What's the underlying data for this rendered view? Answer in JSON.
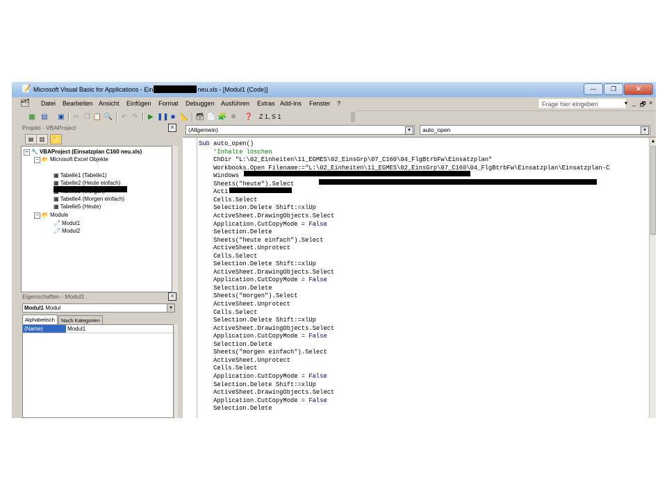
{
  "window": {
    "title_prefix": "Microsoft Visual Basic for Applications - Ein",
    "title_suffix": "neu.xls - [Modul1 (Code)]",
    "buttons": {
      "minimize": "—",
      "restore": "❐",
      "close": "✕"
    }
  },
  "menubar": {
    "items": [
      "Datei",
      "Bearbeiten",
      "Ansicht",
      "Einfügen",
      "Format",
      "Debuggen",
      "Ausführen",
      "Extras",
      "Add-Ins",
      "Fenster",
      "?"
    ],
    "help_placeholder": "Frage hier eingeben",
    "mdi": {
      "dropdown": "▾",
      "minimize": "_",
      "restore": "🗗",
      "close": "×"
    }
  },
  "toolbar": {
    "cursor_position": "Z 1, S 1"
  },
  "project_panel": {
    "title": "Projekt - VBAProject",
    "tree": {
      "project": "VBAProject (Einsatzplan C160 neu.xls)",
      "excel_objects": "Microsoft Excel Objekte",
      "sheets": [
        "Tabelle1 (Tabelle1)",
        "Tabelle2 (Heute einfach)",
        "Tabelle3 (Morgen)",
        "Tabelle4 (Morgen einfach)",
        "Tabelle5 (Heute)"
      ],
      "modules_folder": "Module",
      "modules": [
        "Modul1",
        "Modul2"
      ]
    }
  },
  "properties_panel": {
    "title": "Eigenschaften - Modul1",
    "object_select_name": "Modul1",
    "object_select_type": "Modul",
    "tabs": [
      "Alphabetisch",
      "Nach Kategorien"
    ],
    "rows": [
      {
        "name": "(Name)",
        "value": "Modul1"
      }
    ]
  },
  "code_window": {
    "object_combo": "(Allgemein)",
    "procedure_combo": "auto_open",
    "lines": [
      "Sub auto_open()",
      "    'Inhalte löschen",
      "    ChDir \"L:\\02_Einheiten\\11_EGMES\\02_EinsGrp\\07_C160\\04_FlgBtrbFw\\Einsatzplan\"",
      "    Workbooks.Open Filename:=\"L:\\02_Einheiten\\11_EGMES\\02_EinsGrp\\07_C160\\04_FlgBtrbFw\\Einsatzplan\\Einsatzplan-C",
      "    Windows",
      "    Sheets(\"heute\").Select",
      "    Acti",
      "    Cells.Select",
      "    Selection.Delete Shift:=xlUp",
      "    ActiveSheet.DrawingObjects.Select",
      "    Application.CutCopyMode = False",
      "    Selection.Delete",
      "    Sheets(\"heute einfach\").Select",
      "    ActiveSheet.Unprotect",
      "    Cells.Select",
      "    Selection.Delete Shift:=xlUp",
      "    ActiveSheet.DrawingObjects.Select",
      "    Application.CutCopyMode = False",
      "    Selection.Delete",
      "    Sheets(\"morgen\").Select",
      "    ActiveSheet.Unprotect",
      "    Cells.Select",
      "    Selection.Delete Shift:=xlUp",
      "    ActiveSheet.DrawingObjects.Select",
      "    Application.CutCopyMode = False",
      "    Selection.Delete",
      "    Sheets(\"morgen einfach\").Select",
      "    ActiveSheet.Unprotect",
      "    Cells.Select",
      "    Application.CutCopyMode = False",
      "    Selection.Delete Shift:=xlUp",
      "    ActiveSheet.DrawingObjects.Select",
      "    Application.CutCopyMode = False",
      "    Selection.Delete"
    ],
    "keywords": [
      "Sub",
      "False"
    ],
    "colors": {
      "keyword": "#00007f",
      "comment": "#007f00"
    }
  }
}
